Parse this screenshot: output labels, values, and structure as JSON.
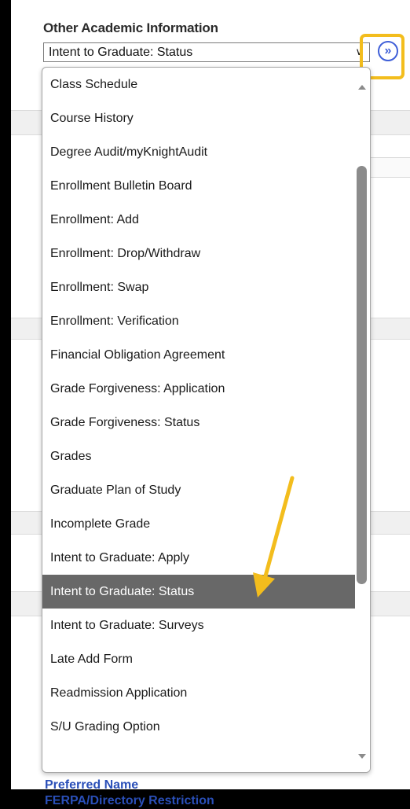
{
  "section": {
    "title": "Other Academic Information",
    "selected_value": "Intent to Graduate: Status",
    "go_icon": "double-chevron-right-icon"
  },
  "dropdown": {
    "options": [
      "Class Schedule",
      "Course History",
      "Degree Audit/myKnightAudit",
      "Enrollment Bulletin Board",
      "Enrollment: Add",
      "Enrollment: Drop/Withdraw",
      "Enrollment: Swap",
      "Enrollment: Verification",
      "Financial Obligation Agreement",
      "Grade Forgiveness: Application",
      "Grade Forgiveness: Status",
      "Grades",
      "Graduate Plan of Study",
      "Incomplete Grade",
      "Intent to Graduate: Apply",
      "Intent to Graduate: Status",
      "Intent to Graduate: Surveys",
      "Late Add Form",
      "Readmission Application",
      "S/U Grading Option"
    ],
    "selected_option": "Intent to Graduate: Status"
  },
  "links": [
    "Preferred Name",
    "FERPA/Directory Restriction"
  ],
  "colors": {
    "highlight": "#f3bd1d",
    "selected_bg": "#686868",
    "link": "#2a4fb8",
    "go_button": "#3f5fd8"
  }
}
